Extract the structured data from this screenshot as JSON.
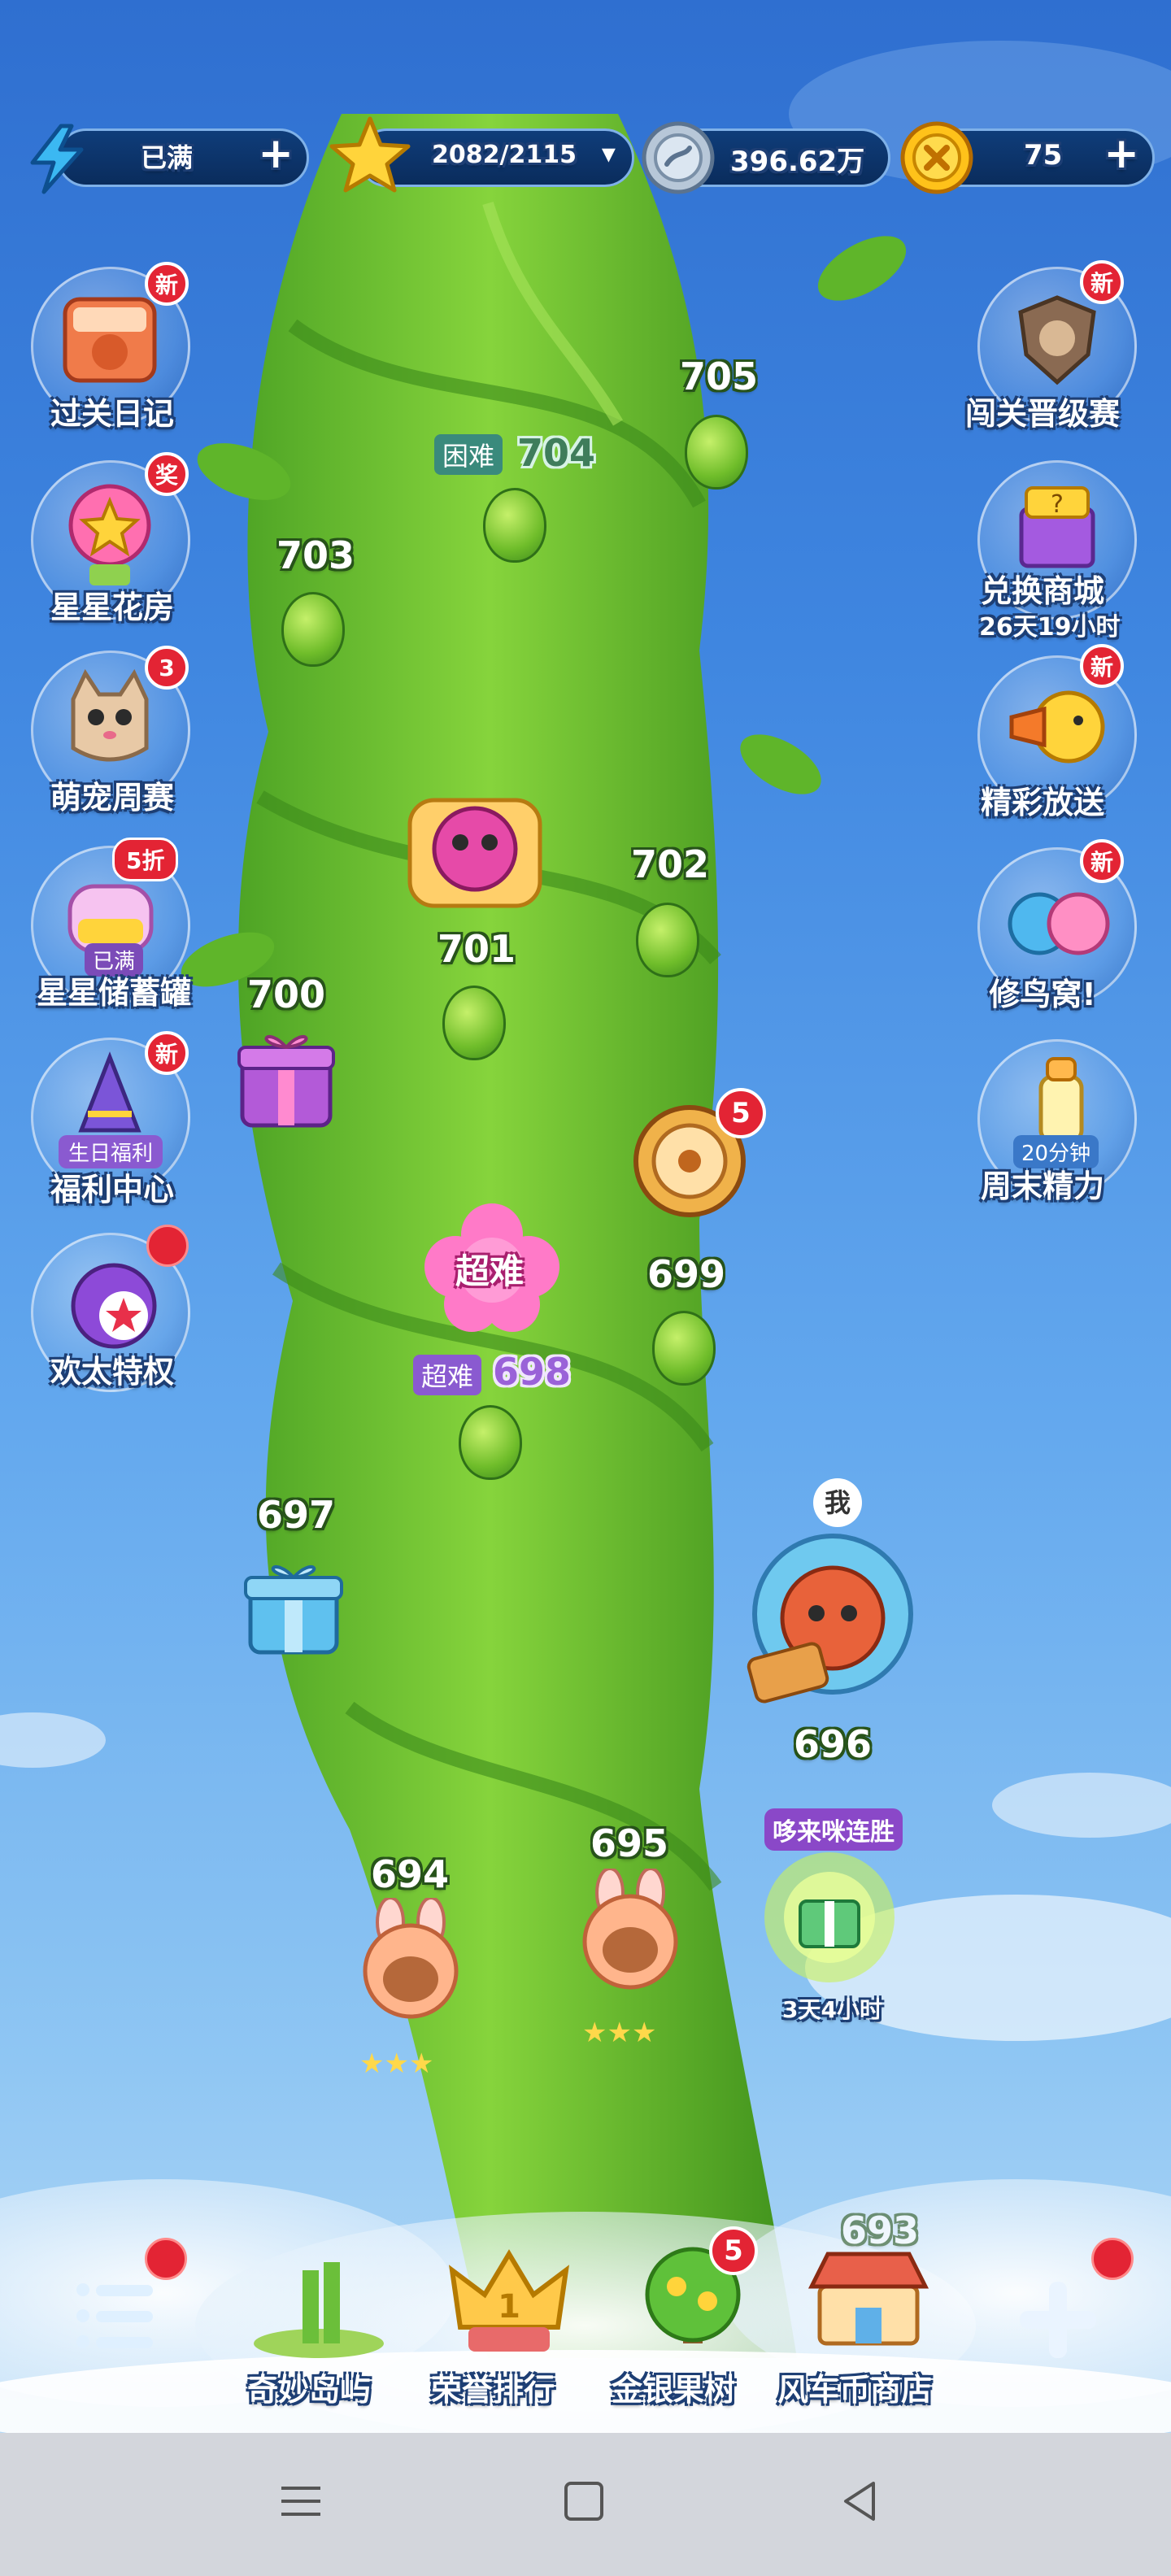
{
  "hud": {
    "energy_status": "已满",
    "stars": "2082/2115",
    "coins": "396.62万",
    "gold": "75"
  },
  "left_menu": [
    {
      "label": "过关日记",
      "badge": "新"
    },
    {
      "label": "星星花房",
      "badge": "奖"
    },
    {
      "label": "萌宠周赛",
      "badge": "3"
    },
    {
      "label": "星星储蓄罐",
      "badge": "5折",
      "sub": "已满"
    },
    {
      "label": "福利中心",
      "badge": "新",
      "sub": "生日福利"
    },
    {
      "label": "欢太特权",
      "badge": ""
    }
  ],
  "right_menu": [
    {
      "label": "闯关晋级赛",
      "badge": "新"
    },
    {
      "label": "兑换商城",
      "sub": "26天19小时"
    },
    {
      "label": "精彩放送",
      "badge": "新"
    },
    {
      "label": "修鸟窝!",
      "badge": "新"
    },
    {
      "label": "周末精力",
      "sub": "20分钟"
    }
  ],
  "map": {
    "levels": {
      "l705": "705",
      "l704": "704",
      "l704_tag": "困难",
      "l703": "703",
      "l702": "702",
      "l701": "701",
      "l700": "700",
      "l699": "699",
      "l698": "698",
      "l698_tag": "超难",
      "l697": "697",
      "l696": "696",
      "l695": "695",
      "l694": "694",
      "l693": "693"
    },
    "super_hard_flower": "超难",
    "wheel_badge": "5",
    "me_label": "我",
    "streak_label": "哆来咪连胜",
    "streak_timer": "3天4小时"
  },
  "bottom_nav": {
    "menu_badge": "",
    "items": [
      {
        "label": "奇妙岛屿"
      },
      {
        "label": "荣誉排行"
      },
      {
        "label": "金银果树",
        "badge": "5"
      },
      {
        "label": "风车币商店"
      }
    ]
  },
  "colors": {
    "sky_top": "#2f6fd0",
    "beanstalk": "#6fbd2a",
    "badge_red": "#e32434",
    "hud_bar": "#0a2c5c"
  }
}
